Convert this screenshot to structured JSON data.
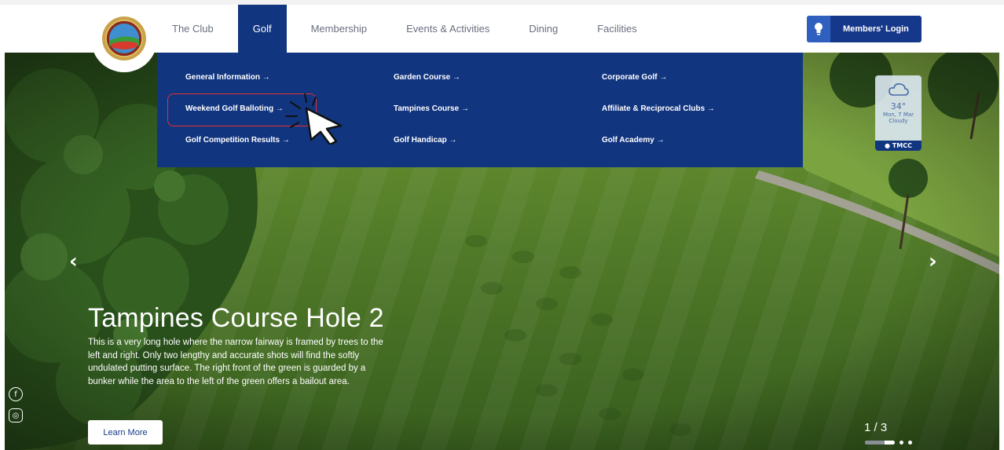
{
  "nav": {
    "items": [
      {
        "label": "The Club",
        "active": false
      },
      {
        "label": "Golf",
        "active": true
      },
      {
        "label": "Membership",
        "active": false
      },
      {
        "label": "Events & Activities",
        "active": false
      },
      {
        "label": "Dining",
        "active": false
      },
      {
        "label": "Facilities",
        "active": false
      }
    ],
    "login_label": "Members' Login"
  },
  "dropdown": {
    "col1": [
      "General Information →",
      "Weekend Golf Balloting →",
      "Golf Competition Results →"
    ],
    "col2": [
      "Garden Course →",
      "Tampines Course →",
      "Golf Handicap →"
    ],
    "col3": [
      "Corporate Golf →",
      "Affiliate & Reciprocal Clubs →",
      "Golf Academy →"
    ],
    "highlighted": "Weekend Golf Balloting"
  },
  "weather": {
    "temp": "34°",
    "date": "Mon, 7 Mar",
    "condition": "Cloudy",
    "location": "TMCC",
    "icon": "cloud-icon"
  },
  "hero": {
    "title": "Tampines Course Hole 2",
    "body": "This is a very long hole where the narrow fairway is framed by trees to the left and right. Only two lengthy and accurate shots will find the softly undulated putting surface. The right front of the green is guarded by a bunker while the area to the left of the green offers a bailout area.",
    "button": "Learn More",
    "prev_icon": "‹",
    "next_icon": "›",
    "pager": "1 / 3",
    "slide_current": 1,
    "slide_total": 3,
    "progress": 0.65
  },
  "social": {
    "facebook_glyph": "f",
    "instagram_glyph": "◎"
  },
  "colors": {
    "brand_blue": "#123580",
    "highlight_red": "#e23030"
  }
}
